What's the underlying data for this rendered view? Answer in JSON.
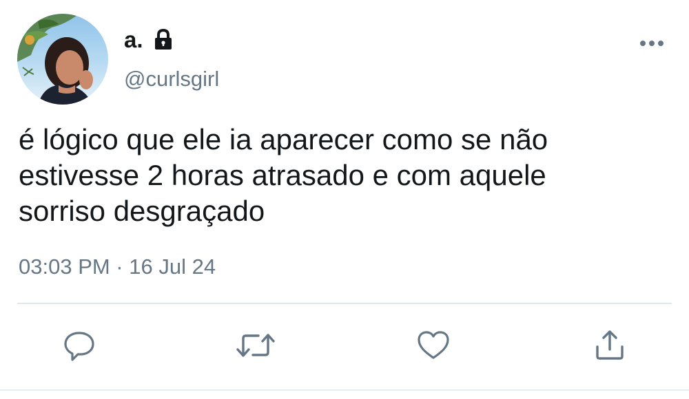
{
  "user": {
    "display_name": "a.",
    "handle": "@curlsgirl",
    "protected": true,
    "avatar_icon": "profile-photo"
  },
  "tweet": {
    "text": "é lógico que ele ia aparecer como se não\nestivesse 2 horas atrasado e com aquele\nsorriso desgraçado",
    "timestamp": "03:03 PM · 16 Jul 24"
  },
  "actions": [
    {
      "name": "reply",
      "icon": "reply-icon"
    },
    {
      "name": "retweet",
      "icon": "retweet-icon"
    },
    {
      "name": "like",
      "icon": "heart-icon"
    },
    {
      "name": "share",
      "icon": "share-icon"
    }
  ],
  "colors": {
    "text": "#14171a",
    "secondary": "#657786",
    "icon": "#657786",
    "divider": "#e1e8ed"
  }
}
